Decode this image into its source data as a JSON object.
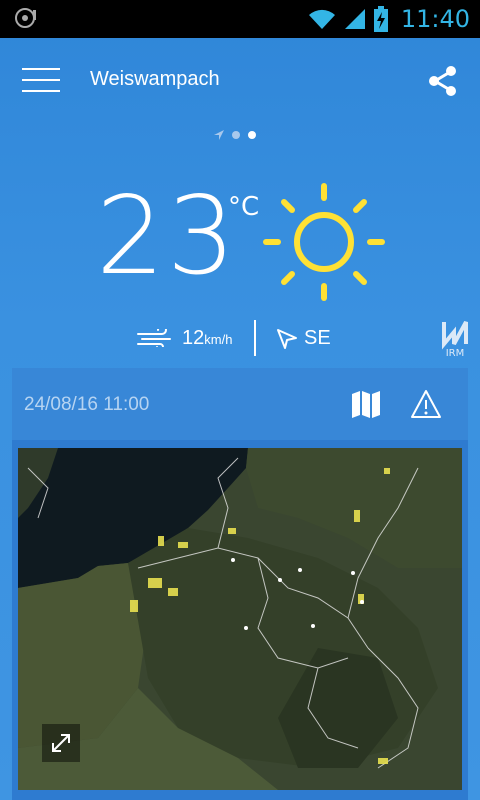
{
  "status_bar": {
    "time": "11:40",
    "left_icon": "notification-icon",
    "icons": [
      "wifi-icon",
      "signal-icon",
      "battery-charging-icon"
    ],
    "accent_color": "#33b5e5"
  },
  "app_bar": {
    "city": "Weiswampach",
    "menu_icon": "hamburger-menu-icon",
    "share_icon": "share-icon"
  },
  "pager": {
    "items": [
      "location-arrow-icon",
      "dot",
      "dot-active"
    ]
  },
  "current": {
    "temperature": "23",
    "unit": "°C",
    "condition_icon": "sun-icon",
    "sun_color": "#ffe135",
    "wind_speed": "12",
    "wind_unit": "km/h",
    "wind_direction": "SE"
  },
  "brand": {
    "logo_text": "IRM"
  },
  "radar": {
    "timestamp": "24/08/16 11:00",
    "map_icon": "map-icon",
    "warning_icon": "warning-icon",
    "expand_icon": "expand-icon"
  }
}
